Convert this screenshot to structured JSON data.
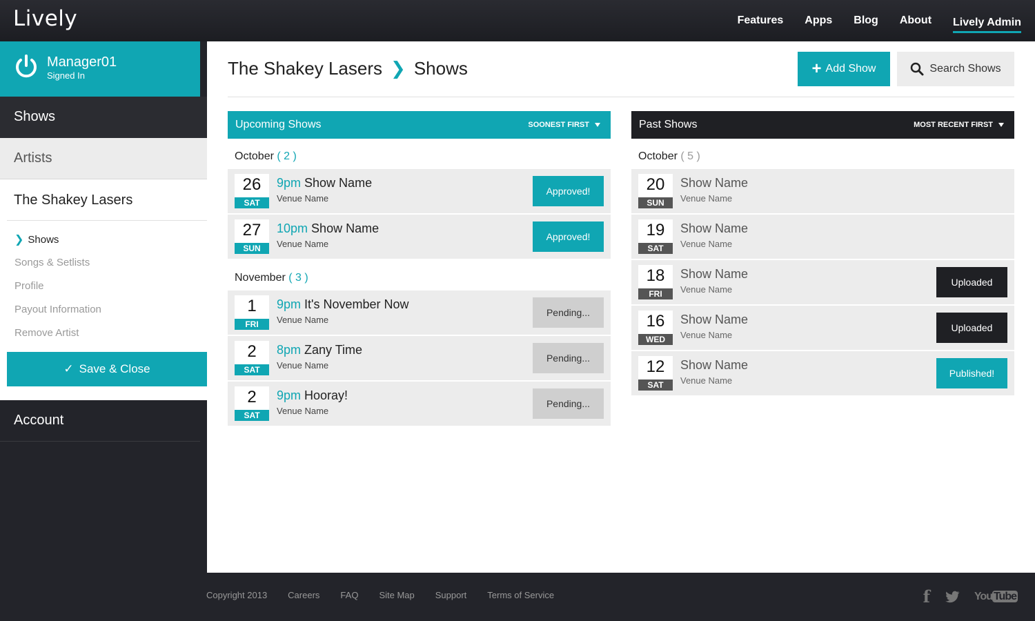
{
  "app": {
    "logo": "Lively"
  },
  "topnav": {
    "items": [
      "Features",
      "Apps",
      "Blog",
      "About",
      "Lively Admin"
    ]
  },
  "user": {
    "name": "Manager01",
    "status": "Signed In"
  },
  "sidebar": {
    "shows": "Shows",
    "artists": "Artists",
    "artist_name": "The Shakey Lasers",
    "sub_items": [
      "Shows",
      "Songs & Setlists",
      "Profile",
      "Payout Information",
      "Remove Artist"
    ],
    "save_label": "Save & Close",
    "save_check": "✓",
    "account": "Account"
  },
  "page": {
    "breadcrumb_artist": "The Shakey Lasers",
    "breadcrumb_sep": "❯",
    "breadcrumb_current": "Shows",
    "add_show": "Add Show",
    "search_shows": "Search Shows"
  },
  "upcoming": {
    "title": "Upcoming Shows",
    "sort": "SOONEST FIRST",
    "months": [
      {
        "name": "October",
        "count": "( 2 )",
        "shows": [
          {
            "day": "26",
            "dow": "SAT",
            "time": "9pm",
            "name": "Show Name",
            "venue": "Venue Name",
            "status": "Approved!"
          },
          {
            "day": "27",
            "dow": "SUN",
            "time": "10pm",
            "name": "Show Name",
            "venue": "Venue Name",
            "status": "Approved!"
          }
        ]
      },
      {
        "name": "November",
        "count": "( 3 )",
        "shows": [
          {
            "day": "1",
            "dow": "FRI",
            "time": "9pm",
            "name": "It's November Now",
            "venue": "Venue Name",
            "status": "Pending..."
          },
          {
            "day": "2",
            "dow": "SAT",
            "time": "8pm",
            "name": "Zany Time",
            "venue": "Venue Name",
            "status": "Pending..."
          },
          {
            "day": "2",
            "dow": "SAT",
            "time": "9pm",
            "name": "Hooray!",
            "venue": "Venue Name",
            "status": "Pending..."
          }
        ]
      }
    ]
  },
  "past": {
    "title": "Past Shows",
    "sort": "MOST RECENT FIRST",
    "months": [
      {
        "name": "October",
        "count": "( 5 )",
        "shows": [
          {
            "day": "20",
            "dow": "SUN",
            "name": "Show Name",
            "venue": "Venue Name",
            "status": ""
          },
          {
            "day": "19",
            "dow": "SAT",
            "name": "Show Name",
            "venue": "Venue Name",
            "status": ""
          },
          {
            "day": "18",
            "dow": "FRI",
            "name": "Show Name",
            "venue": "Venue Name",
            "status": "Uploaded"
          },
          {
            "day": "16",
            "dow": "WED",
            "name": "Show Name",
            "venue": "Venue Name",
            "status": "Uploaded"
          },
          {
            "day": "12",
            "dow": "SAT",
            "name": "Show Name",
            "venue": "Venue Name",
            "status": "Published!"
          }
        ]
      }
    ]
  },
  "footer": {
    "links": [
      "Copyright 2013",
      "Careers",
      "FAQ",
      "Site Map",
      "Support",
      "Terms of Service"
    ],
    "social": {
      "facebook": "f",
      "youtube_you": "You",
      "youtube_tube": "Tube"
    }
  },
  "colors": {
    "accent": "#10a6b3",
    "dark": "#23242a",
    "panel": "#ececec"
  }
}
